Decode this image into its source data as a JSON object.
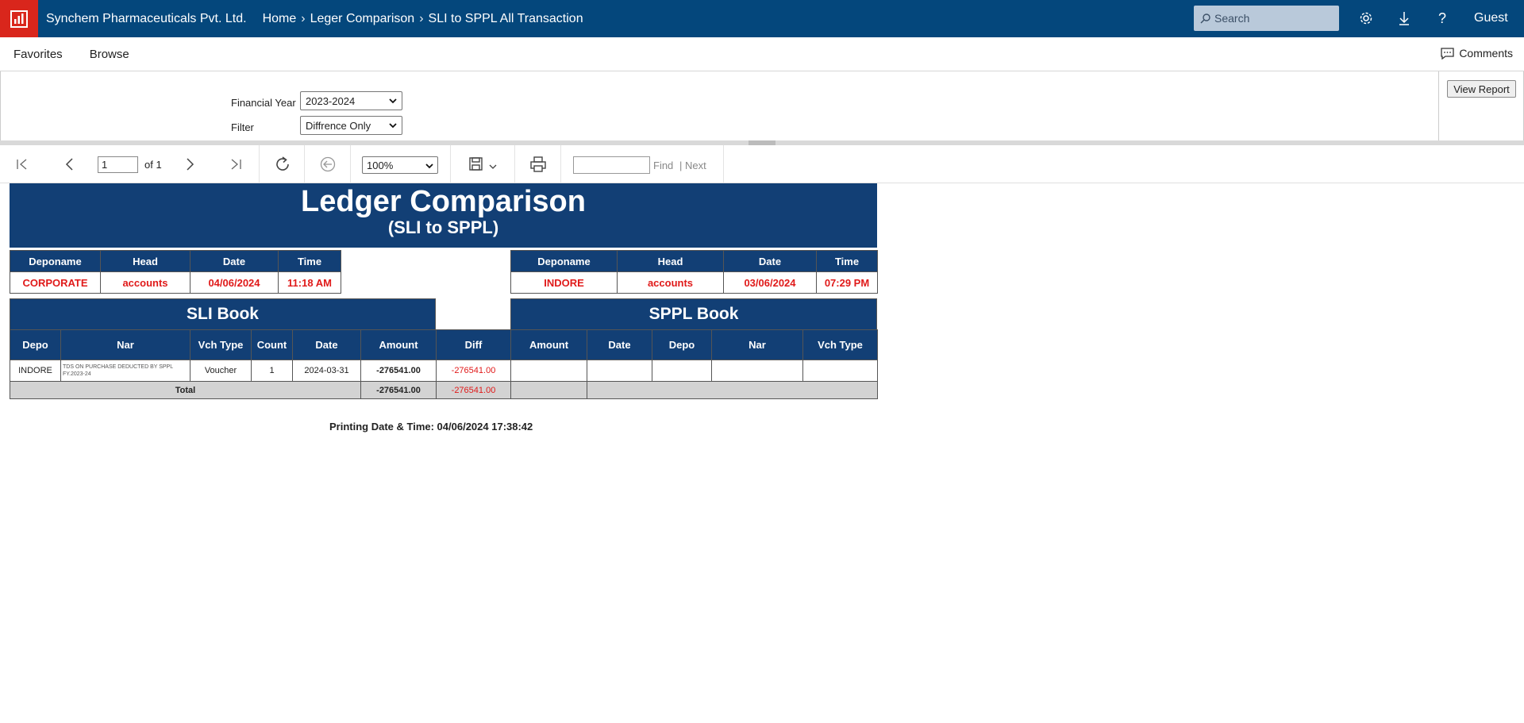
{
  "appbar": {
    "company": "Synchem Pharmaceuticals Pvt. Ltd.",
    "breadcrumbs": [
      "Home",
      "Leger Comparison",
      "SLI to SPPL All Transaction"
    ],
    "search_placeholder": "Search",
    "user": "Guest"
  },
  "favbar": {
    "favorites": "Favorites",
    "browse": "Browse",
    "comments": "Comments"
  },
  "params": {
    "fy_label": "Financial Year",
    "fy_value": "2023-2024",
    "filter_label": "Filter",
    "filter_value": "Diffrence Only",
    "view_report": "View Report"
  },
  "toolbar": {
    "page": "1",
    "of": "of 1",
    "zoom": "100%",
    "find": "Find",
    "next": "Next"
  },
  "report": {
    "title": "Ledger Comparison",
    "subtitle": "(SLI to SPPL)",
    "info_headers": [
      "Deponame",
      "Head",
      "Date",
      "Time"
    ],
    "left_info": [
      "CORPORATE",
      "accounts",
      "04/06/2024",
      "11:18 AM"
    ],
    "right_info": [
      "INDORE",
      "accounts",
      "03/06/2024",
      "07:29 PM"
    ],
    "sli_book": "SLI Book",
    "sppl_book": "SPPL Book",
    "columns": [
      "Depo",
      "Nar",
      "Vch Type",
      "Count",
      "Date",
      "Amount",
      "Diff",
      "Amount",
      "Date",
      "Depo",
      "Nar",
      "Vch Type"
    ],
    "row": {
      "depo": "INDORE",
      "nar": "TDS ON PURCHASE DEDUCTED BY SPPL FY.2023-24",
      "vch_type": "Voucher",
      "count": "1",
      "date": "2024-03-31",
      "amount": "-276541.00",
      "diff": "-276541.00"
    },
    "total_label": "Total",
    "total_amount": "-276541.00",
    "total_diff": "-276541.00",
    "printing": "Printing Date & Time: 04/06/2024 17:38:42"
  }
}
